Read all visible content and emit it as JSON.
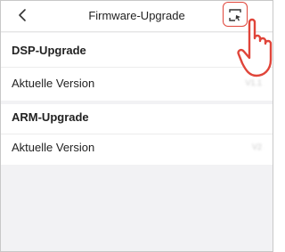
{
  "header": {
    "back_icon": "chevron-left-icon",
    "title": "Firmware-Upgrade",
    "scan_icon": "scan-icon"
  },
  "sections": [
    {
      "heading": "DSP-Upgrade",
      "rows": [
        {
          "label": "Aktuelle Version",
          "value": "V1.1"
        }
      ]
    },
    {
      "heading": "ARM-Upgrade",
      "rows": [
        {
          "label": "Aktuelle Version",
          "value": "V2"
        }
      ]
    }
  ],
  "accent_color": "#e0453a"
}
